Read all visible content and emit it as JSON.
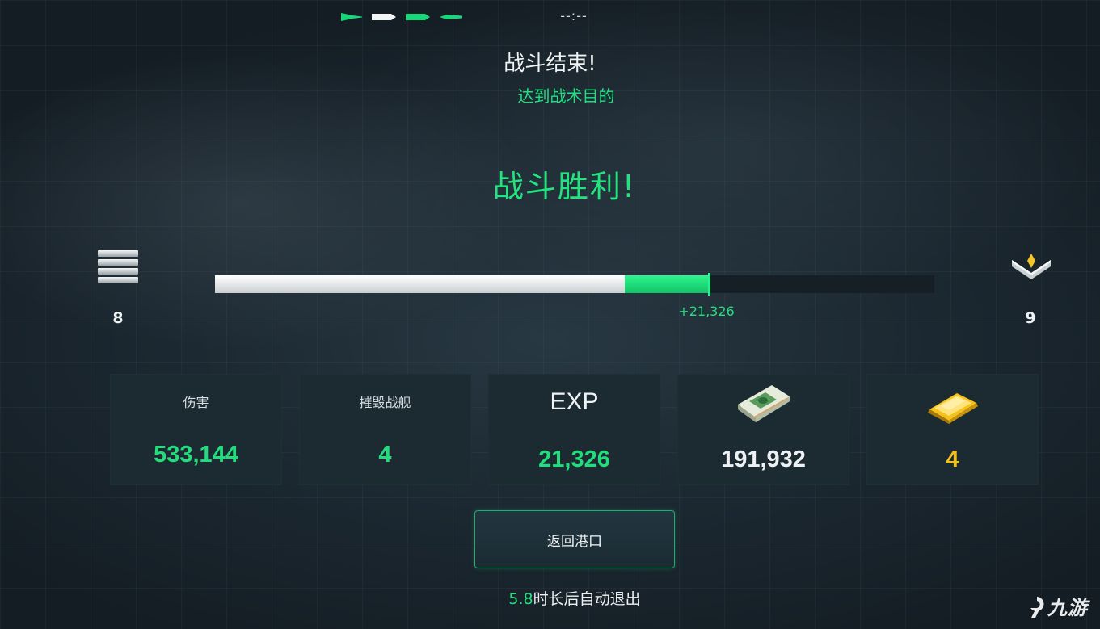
{
  "header": {
    "timer": "--:--",
    "title": "战斗结束!",
    "subtitle": "达到战术目的"
  },
  "result": {
    "text": "战斗胜利!"
  },
  "rank": {
    "current_level": "8",
    "next_level": "9",
    "progress_gain": "+21,326",
    "progress_before_fraction": 0.57,
    "progress_after_fraction": 0.686
  },
  "stats": [
    {
      "label": "伤害",
      "value": "533,144"
    },
    {
      "label": "摧毁战舰",
      "value": "4"
    },
    {
      "label": "EXP",
      "value": "21,326"
    },
    {
      "icon": "cash-icon",
      "value": "191,932"
    },
    {
      "icon": "gold-bar-icon",
      "value": "4"
    }
  ],
  "actions": {
    "return_label": "返回港口"
  },
  "auto_exit": {
    "seconds": "5.8",
    "text": "时长后自动退出"
  },
  "watermark": {
    "text": "九游"
  },
  "colors": {
    "accent_green": "#22e07e",
    "gold": "#f1c21f",
    "background": "#1d2a33"
  }
}
